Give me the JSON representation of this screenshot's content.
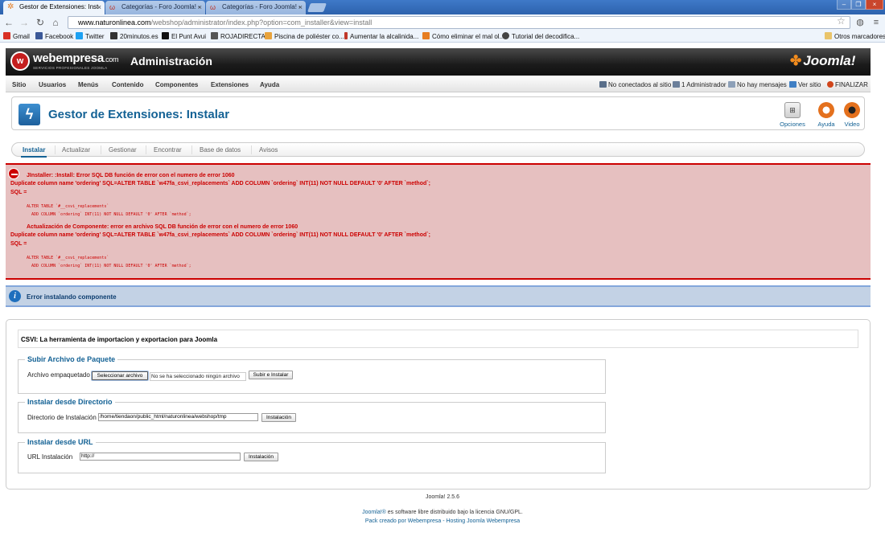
{
  "browser": {
    "tabs": [
      {
        "title": "Gestor de Extensiones: Inst",
        "active": true
      },
      {
        "title": "Categorías - Foro Joomla! - ",
        "active": false
      },
      {
        "title": "Categorías - Foro Joomla! - ",
        "active": false
      }
    ],
    "url_domain": "www.naturonlinea.com",
    "url_path": "/webshop/administrator/index.php?option=com_installer&view=install",
    "bookmarks": [
      {
        "label": "Gmail",
        "color": "#d93025"
      },
      {
        "label": "Facebook",
        "color": "#3b5998"
      },
      {
        "label": "Twitter",
        "color": "#1da1f2"
      },
      {
        "label": "20minutos.es",
        "color": "#333333"
      },
      {
        "label": "El Punt Avui",
        "color": "#111111"
      },
      {
        "label": "ROJADIRECTA",
        "color": "#555555"
      },
      {
        "label": "Piscina de poliéster co...",
        "color": "#e8a33c"
      },
      {
        "label": "Aumentar la alcalinida...",
        "color": "#c0392b"
      },
      {
        "label": "Cómo eliminar el mal ol...",
        "color": "#e67e22"
      },
      {
        "label": "Tutorial del decodifica...",
        "color": "#444444"
      }
    ],
    "other_bookmarks": "Otros marcadores"
  },
  "header": {
    "brand": "webempresa",
    "brand_tld": ".com",
    "brand_sub": "SERVICIOS PROFESIONALES JOOMLA",
    "admin_title": "Administración",
    "joomla_logo": "Joomla!"
  },
  "menu": {
    "items": [
      "Sitio",
      "Usuarios",
      "Menús",
      "Contenido",
      "Componentes",
      "Extensiones",
      "Ayuda"
    ],
    "status": [
      {
        "label": "No conectados al sitio",
        "color": "#5a6f8a"
      },
      {
        "label": "1 Administrador",
        "color": "#6b7f9a"
      },
      {
        "label": "No hay mensajes",
        "color": "#8da0b8"
      },
      {
        "label": "Ver sitio",
        "color": "#3f7fc4"
      },
      {
        "label": "FINALIZAR",
        "color": "#d0451b"
      }
    ]
  },
  "toolbar": {
    "title": "Gestor de Extensiones: Instalar",
    "buttons": [
      {
        "label": "Opciones",
        "icon": "options-icon"
      },
      {
        "label": "Ayuda",
        "icon": "help-lifebuoy-icon"
      },
      {
        "label": "Video",
        "icon": "video-icon"
      }
    ]
  },
  "subnav": {
    "items": [
      "Instalar",
      "Actualizar",
      "Gestionar",
      "Encontrar",
      "Base de datos",
      "Avisos"
    ],
    "active": "Instalar"
  },
  "errors": [
    {
      "heading": "JInstaller: :Install: Error SQL DB función de error con el numero de error 1060",
      "line1": "Duplicate column name 'ordering' SQL=ALTER TABLE `w47fa_csvi_replacements` ADD COLUMN `ordering` INT(11) NOT NULL DEFAULT '0' AFTER `method`;",
      "line2": "SQL =",
      "sql1": "ALTER TABLE `#__csvi_replacements`",
      "sql2": "ADD COLUMN `ordering` INT(11) NOT NULL DEFAULT '0' AFTER `method`;"
    },
    {
      "heading": "Actualización de Componente: error en archivo SQL DB función de error con el numero de error 1060",
      "line1": "Duplicate column name 'ordering' SQL=ALTER TABLE `w47fa_csvi_replacements` ADD COLUMN `ordering` INT(11) NOT NULL DEFAULT '0' AFTER `method`;",
      "line2": "SQL =",
      "sql1": "ALTER TABLE `#__csvi_replacements`",
      "sql2": "ADD COLUMN `ordering` INT(11) NOT NULL DEFAULT '0' AFTER `method`;"
    }
  ],
  "info_message": "Error instalando componente",
  "component_desc": "CSVI: La herramienta de importacion y exportacion para Joomla",
  "upload": {
    "legend": "Subir Archivo de Paquete",
    "label": "Archivo empaquetado",
    "choose_button": "Seleccionar archivo",
    "no_file": "No se ha seleccionado ningún archivo",
    "submit": "Subir e Instalar"
  },
  "directory": {
    "legend": "Instalar desde Directorio",
    "label": "Directorio de Instalación",
    "value": "/home/tiendaon/public_html/naturonlinea/webshop/tmp",
    "submit": "Instalación"
  },
  "url_install": {
    "legend": "Instalar desde URL",
    "label": "URL Instalación",
    "value": "http://",
    "submit": "Instalación"
  },
  "footer": {
    "version": "Joomla! 2.5.6",
    "license_link": "Joomla!®",
    "license_text": " es software libre distribuido bajo la licencia GNU/GPL.",
    "credit": "Pack creado por Webempresa - Hosting Joomla Webempresa"
  }
}
